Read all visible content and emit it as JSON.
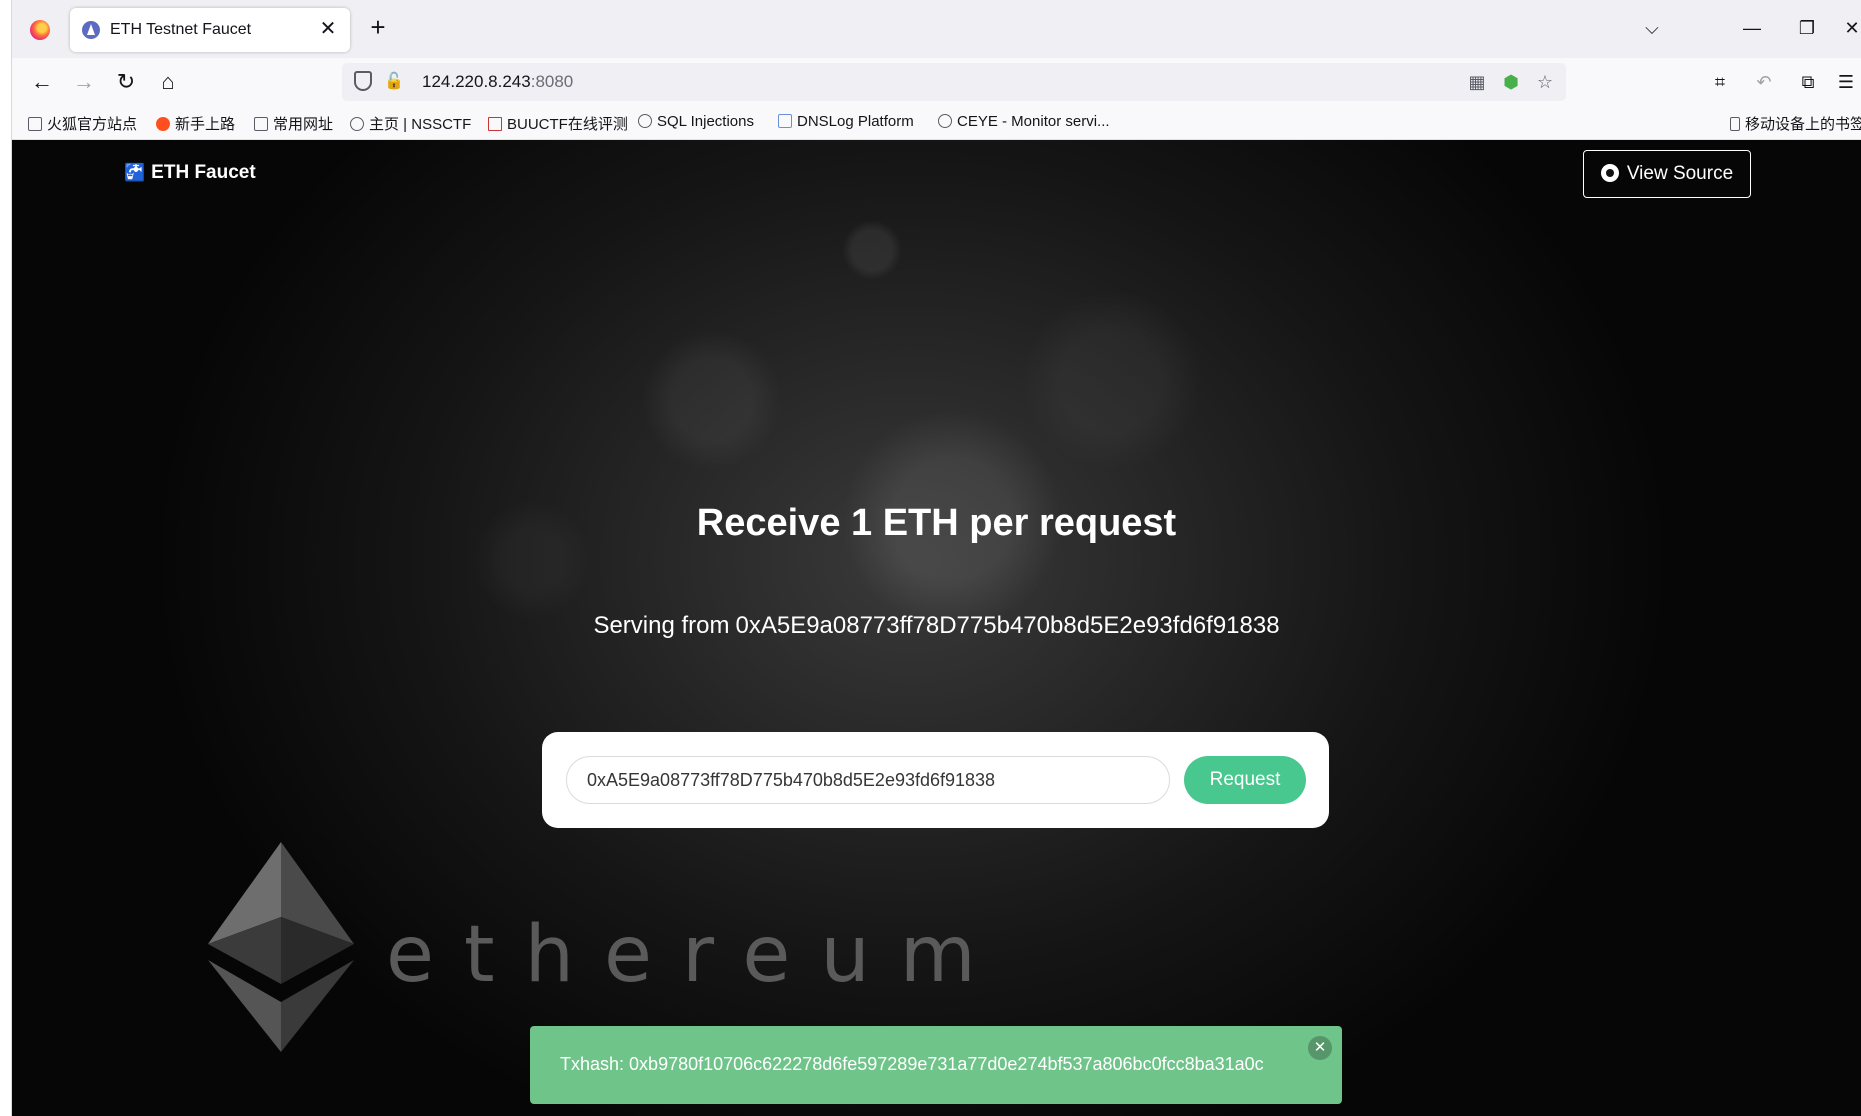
{
  "browser": {
    "tab": {
      "title": "ETH Testnet Faucet",
      "close": "✕"
    },
    "new_tab": "+",
    "tab_list": "⌵",
    "window_controls": {
      "minimize": "—",
      "restore": "❐",
      "close": "✕"
    },
    "nav": {
      "back": "←",
      "forward": "→",
      "reload": "↻",
      "home": "⌂"
    },
    "url": {
      "host": "124.220.8.243",
      "port": ":8080"
    },
    "url_icons": [
      "qr-code-icon",
      "extension-icon",
      "star-icon"
    ],
    "toolbar_icons": [
      "crop-icon",
      "undo-icon",
      "extensions-icon",
      "menu-icon"
    ],
    "bookmarks": [
      {
        "label": "火狐官方站点",
        "icon": "folder-icon"
      },
      {
        "label": "新手上路",
        "icon": "firefox-icon"
      },
      {
        "label": "常用网址",
        "icon": "folder-icon"
      },
      {
        "label": "主页 | NSSCTF",
        "icon": "globe-icon"
      },
      {
        "label": "BUUCTF在线评测",
        "icon": "buuctf-icon"
      },
      {
        "label": "SQL Injections",
        "icon": "globe-icon"
      },
      {
        "label": "DNSLog Platform",
        "icon": "dnslog-icon"
      },
      {
        "label": "CEYE - Monitor servi...",
        "icon": "ceye-icon"
      }
    ],
    "mobile_bookmarks": "移动设备上的书签"
  },
  "page": {
    "brand": "ETH Faucet",
    "view_source": "View Source",
    "headline": "Receive 1 ETH per request",
    "serving_prefix": "Serving from",
    "serving_address": "0xA5E9a08773ff78D775b470b8d5E2e93fd6f91838",
    "address_input_value": "0xA5E9a08773ff78D775b470b8d5E2e93fd6f91838",
    "request_button": "Request",
    "ethereum_word": "ethereum",
    "toast": {
      "label": "Txhash:",
      "hash": "0xb9780f10706c622278d6fe597289e731a77d0e274bf537a806bc0fcc8ba31a0c",
      "close": "✕"
    }
  },
  "colors": {
    "request_button": "#48c78e",
    "toast": "#6fc48a"
  }
}
